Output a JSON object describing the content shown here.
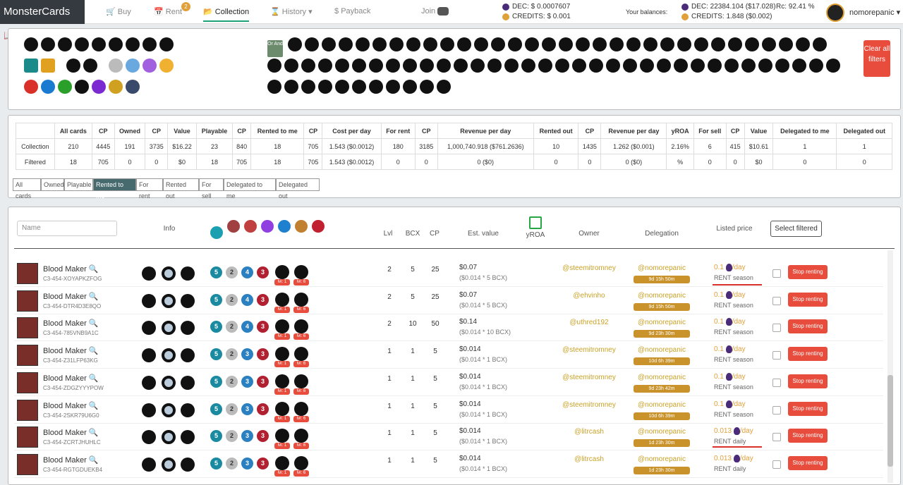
{
  "nav": {
    "brand": "MonsterCards",
    "buy": "Buy",
    "rent": "Rent",
    "rent_badge": "2",
    "collection": "Collection",
    "history": "History",
    "payback": "Payback",
    "join": "Join",
    "dec_price": "DEC: $ 0.0007607",
    "credits_price": "CREDITS: $ 0.001",
    "balances_label": "Your balances:",
    "dec_balance": "DEC: 22384.104 ($17.028)",
    "credits_balance": "CREDITS: 1.848 ($0.002)",
    "rc": "Rc: 92.41 %",
    "username": "nomorepanic"
  },
  "filters": {
    "or_and": "Or And",
    "clear_label": "Clear all filters"
  },
  "stats_table": {
    "headers": [
      "",
      "All cards",
      "CP",
      "Owned",
      "CP",
      "Value",
      "Playable",
      "CP",
      "Rented to me",
      "CP",
      "Cost per day",
      "For rent",
      "CP",
      "Revenue per day",
      "Rented out",
      "CP",
      "Revenue per day",
      "yROA",
      "For sell",
      "CP",
      "Value",
      "Delegated to me",
      "Delegated out"
    ],
    "rows": [
      [
        "Collection",
        "210",
        "4445",
        "191",
        "3735",
        "$16.22",
        "23",
        "840",
        "18",
        "705",
        "1.543 ($0.0012)",
        "180",
        "3185",
        "1,000,740.918 ($761.2636)",
        "10",
        "1435",
        "1.262 ($0.001)",
        "2.16%",
        "6",
        "415",
        "$10.61",
        "1",
        "1"
      ],
      [
        "Filtered",
        "18",
        "705",
        "0",
        "0",
        "$0",
        "18",
        "705",
        "18",
        "705",
        "1.543 ($0.0012)",
        "0",
        "0",
        "0 ($0)",
        "0",
        "0",
        "0 ($0)",
        "%",
        "0",
        "0",
        "$0",
        "0",
        "0"
      ]
    ]
  },
  "view_buttons": [
    "All cards",
    "Owned",
    "Playable",
    "Rented to me",
    "For rent",
    "Rented out",
    "For sell",
    "Delegated to me",
    "Delegated out"
  ],
  "list_header": {
    "name_placeholder": "Name",
    "info": "Info",
    "lvl": "Lvl",
    "bcx": "BCX",
    "cp": "CP",
    "est_value": "Est. value",
    "yroa": "yROA",
    "owner": "Owner",
    "delegation": "Delegation",
    "listed_price": "Listed price",
    "select_filtered": "Select filtered"
  },
  "cards": [
    {
      "name": "Blood Maker",
      "id": "C3-454-XOYAPKZFOG",
      "mana": "5",
      "atk": "2",
      "spd": "4",
      "hp": "3",
      "lvl1": "lvl: 1",
      "lvl2": "lvl: 6",
      "lvl": "2",
      "bcx": "5",
      "cp": "25",
      "value": "$0.07",
      "value_sub": "($0.014 * 5 BCX)",
      "owner": "@steemitromney",
      "delegation": "@nomorepanic",
      "timer": "9d 15h 50m",
      "price": "0.1",
      "per": "/day",
      "rent": "RENT",
      "period": "season",
      "stop": "Stop renting"
    },
    {
      "name": "Blood Maker",
      "id": "C3-454-DTR4D3E8QO",
      "mana": "5",
      "atk": "2",
      "spd": "4",
      "hp": "3",
      "lvl1": "lvl: 1",
      "lvl2": "lvl: 6",
      "lvl": "2",
      "bcx": "5",
      "cp": "25",
      "value": "$0.07",
      "value_sub": "($0.014 * 5 BCX)",
      "owner": "@ehvinho",
      "delegation": "@nomorepanic",
      "timer": "9d 15h 50m",
      "price": "0.1",
      "per": "/day",
      "rent": "RENT",
      "period": "season",
      "stop": "Stop renting"
    },
    {
      "name": "Blood Maker",
      "id": "C3-454-785VNB9A1C",
      "mana": "5",
      "atk": "2",
      "spd": "4",
      "hp": "3",
      "lvl1": "lvl: 1",
      "lvl2": "lvl: 6",
      "lvl": "2",
      "bcx": "10",
      "cp": "50",
      "value": "$0.14",
      "value_sub": "($0.014 * 10 BCX)",
      "owner": "@uthred192",
      "delegation": "@nomorepanic",
      "timer": "9d 23h 30m",
      "price": "0.1",
      "per": "/day",
      "rent": "RENT",
      "period": "season",
      "stop": "Stop renting"
    },
    {
      "name": "Blood Maker",
      "id": "C3-454-Z31LFP63KG",
      "mana": "5",
      "atk": "2",
      "spd": "3",
      "hp": "3",
      "lvl1": "lvl: 1",
      "lvl2": "lvl: 6",
      "lvl": "1",
      "bcx": "1",
      "cp": "5",
      "value": "$0.014",
      "value_sub": "($0.014 * 1 BCX)",
      "owner": "@steemitromney",
      "delegation": "@nomorepanic",
      "timer": "10d 6h 39m",
      "price": "0.1",
      "per": "/day",
      "rent": "RENT",
      "period": "season",
      "stop": "Stop renting"
    },
    {
      "name": "Blood Maker",
      "id": "C3-454-ZDGZYYYPOW",
      "mana": "5",
      "atk": "2",
      "spd": "3",
      "hp": "3",
      "lvl1": "lvl: 1",
      "lvl2": "lvl: 6",
      "lvl": "1",
      "bcx": "1",
      "cp": "5",
      "value": "$0.014",
      "value_sub": "($0.014 * 1 BCX)",
      "owner": "@steemitromney",
      "delegation": "@nomorepanic",
      "timer": "9d 23h 42m",
      "price": "0.1",
      "per": "/day",
      "rent": "RENT",
      "period": "season",
      "stop": "Stop renting"
    },
    {
      "name": "Blood Maker",
      "id": "C3-454-2SKR79U6G0",
      "mana": "5",
      "atk": "2",
      "spd": "3",
      "hp": "3",
      "lvl1": "lvl: 1",
      "lvl2": "lvl: 6",
      "lvl": "1",
      "bcx": "1",
      "cp": "5",
      "value": "$0.014",
      "value_sub": "($0.014 * 1 BCX)",
      "owner": "@steemitromney",
      "delegation": "@nomorepanic",
      "timer": "10d 6h 39m",
      "price": "0.1",
      "per": "/day",
      "rent": "RENT",
      "period": "season",
      "stop": "Stop renting"
    },
    {
      "name": "Blood Maker",
      "id": "C3-454-ZCRTJHUHLC",
      "mana": "5",
      "atk": "2",
      "spd": "3",
      "hp": "3",
      "lvl1": "lvl: 1",
      "lvl2": "lvl: 6",
      "lvl": "1",
      "bcx": "1",
      "cp": "5",
      "value": "$0.014",
      "value_sub": "($0.014 * 1 BCX)",
      "owner": "@litrcash",
      "delegation": "@nomorepanic",
      "timer": "1d 23h 30m",
      "price": "0.013",
      "per": "/day",
      "rent": "RENT",
      "period": "daily",
      "stop": "Stop renting"
    },
    {
      "name": "Blood Maker",
      "id": "C3-454-RGTGDUEKB4",
      "mana": "5",
      "atk": "2",
      "spd": "3",
      "hp": "3",
      "lvl1": "lvl: 1",
      "lvl2": "lvl: 6",
      "lvl": "1",
      "bcx": "1",
      "cp": "5",
      "value": "$0.014",
      "value_sub": "($0.014 * 1 BCX)",
      "owner": "@litrcash",
      "delegation": "@nomorepanic",
      "timer": "1d 23h 30m",
      "price": "0.013",
      "per": "/day",
      "rent": "RENT",
      "period": "daily",
      "stop": "Stop renting"
    }
  ],
  "colors": {
    "accent": "#1aa37a",
    "danger": "#e74c3c",
    "gold": "#c9a227",
    "active_tab": "#476a6f"
  }
}
